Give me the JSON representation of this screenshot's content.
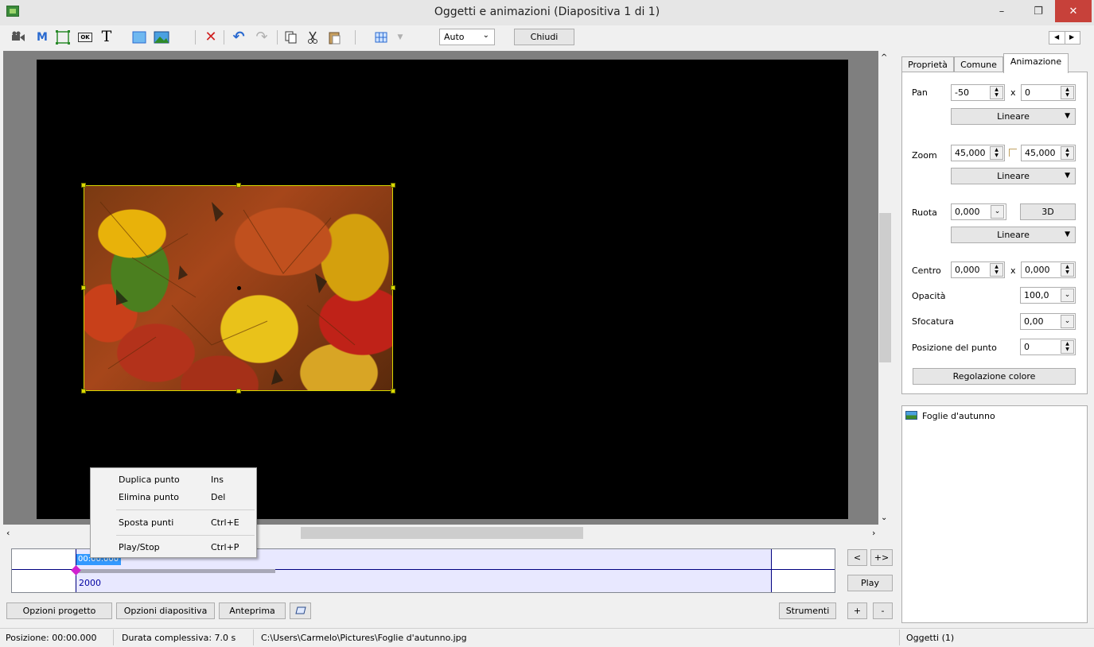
{
  "window": {
    "title": "Oggetti e animazioni  (Diapositiva 1 di 1)",
    "minimize": "–",
    "restore": "❐",
    "close": "✕"
  },
  "toolbar": {
    "icons": [
      "camera-icon",
      "mask-icon",
      "frame-icon",
      "button-icon",
      "text-icon",
      "rectangle-icon",
      "image-icon",
      "delete-icon",
      "undo-icon",
      "redo-icon",
      "copy-icon",
      "cut-icon",
      "paste-icon",
      "grid-icon"
    ],
    "text_icon_label": "T",
    "mask_icon_label": "M",
    "button_icon_label": "OK",
    "delete_glyph": "✕",
    "undo_glyph": "↶",
    "redo_glyph": "↷",
    "zoom_value": "Auto",
    "close_label": "Chiudi"
  },
  "context_menu": {
    "items": [
      {
        "label": "Duplica punto",
        "shortcut": "Ins"
      },
      {
        "label": "Elimina punto",
        "shortcut": "Del"
      },
      {
        "label": "Sposta punti",
        "shortcut": "Ctrl+E"
      },
      {
        "label": "Play/Stop",
        "shortcut": "Ctrl+P"
      }
    ]
  },
  "timeline": {
    "time": "00:00.000",
    "value": "2000",
    "prev_label": "<",
    "next_label": "+>",
    "play_label": "Play",
    "add_label": "+",
    "remove_label": "-"
  },
  "bottom_buttons": {
    "project_options": "Opzioni progetto",
    "slide_options": "Opzioni diapositiva",
    "preview": "Anteprima",
    "tools": "Strumenti"
  },
  "tabs": {
    "properties": "Proprietà",
    "common": "Comune",
    "animation": "Animazione"
  },
  "animation": {
    "pan_label": "Pan",
    "pan_x": "-50",
    "pan_sep": "x",
    "pan_y": "0",
    "pan_interp": "Lineare",
    "zoom_label": "Zoom",
    "zoom_x": "45,000",
    "zoom_y": "45,000",
    "zoom_interp": "Lineare",
    "rotate_label": "Ruota",
    "rotate_value": "0,000",
    "btn_3d": "3D",
    "rotate_interp": "Lineare",
    "center_label": "Centro",
    "center_x": "0,000",
    "center_sep": "x",
    "center_y": "0,000",
    "opacity_label": "Opacità",
    "opacity_value": "100,0",
    "blur_label": "Sfocatura",
    "blur_value": "0,00",
    "point_pos_label": "Posizione del punto",
    "point_pos_value": "0",
    "color_adjust": "Regolazione colore"
  },
  "objects": {
    "items": [
      "Foglie d'autunno"
    ],
    "count_label": "Oggetti (1)"
  },
  "status": {
    "position": "Posizione:  00:00.000",
    "duration": "Durata complessiva:  7.0 s",
    "path": "C:\\Users\\Carmelo\\Pictures\\Foglie d'autunno.jpg"
  },
  "colors": {
    "selection_handle": "#d8d800",
    "timeline_band": "#e8e8ff",
    "timeline_time_bg": "#3399ff",
    "close_button": "#c7413a"
  }
}
